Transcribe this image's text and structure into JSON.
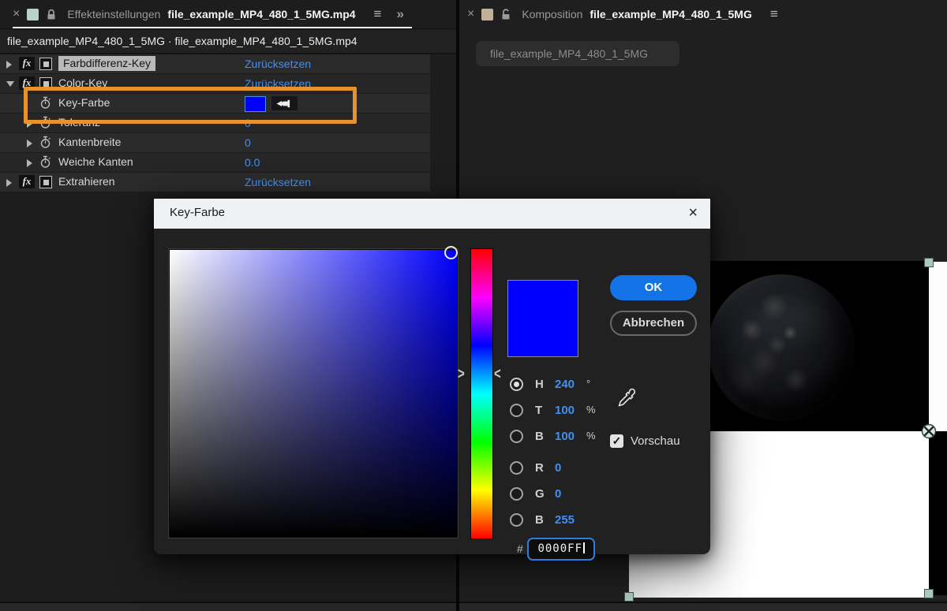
{
  "colors": {
    "key_color": "#0000ff",
    "accent_blue": "#4090f5",
    "annotation_orange": "#e6922f",
    "ok_blue": "#1473e6",
    "handle_teal": "#abc8bd"
  },
  "icons": {
    "close": "×",
    "menu": "≡",
    "overflow": "»",
    "fx": "fx",
    "check": "✓",
    "hue_arrow_left": ">",
    "hue_arrow_right": "<"
  },
  "left_panel": {
    "tab": {
      "panel_label": "Effekteinstellungen",
      "document": "file_example_MP4_480_1_5MG.mp4"
    },
    "subtitle": "file_example_MP4_480_1_5MG · file_example_MP4_480_1_5MG.mp4",
    "rows": [
      {
        "name": "Farbdifferenz-Key",
        "value": "Zurücksetzen"
      },
      {
        "name": "Color-Key",
        "value": "Zurücksetzen"
      },
      {
        "name": "Key-Farbe",
        "value": ""
      },
      {
        "name": "Toleranz",
        "value": "0"
      },
      {
        "name": "Kantenbreite",
        "value": "0"
      },
      {
        "name": "Weiche Kanten",
        "value": "0.0"
      },
      {
        "name": "Extrahieren",
        "value": "Zurücksetzen"
      }
    ]
  },
  "right_panel": {
    "tab": {
      "panel_label": "Komposition",
      "document": "file_example_MP4_480_1_5MG"
    },
    "chip": "file_example_MP4_480_1_5MG"
  },
  "dialog": {
    "title": "Key-Farbe",
    "ok": "OK",
    "cancel": "Abbrechen",
    "preview": "Vorschau",
    "hex_prefix": "#",
    "hex_value": "0000FF",
    "fields": [
      {
        "label": "H",
        "value": "240",
        "unit": "°"
      },
      {
        "label": "T",
        "value": "100",
        "unit": "%"
      },
      {
        "label": "B",
        "value": "100",
        "unit": "%"
      },
      {
        "label": "R",
        "value": "0",
        "unit": ""
      },
      {
        "label": "G",
        "value": "0",
        "unit": ""
      },
      {
        "label": "B",
        "value": "255",
        "unit": ""
      }
    ],
    "hue_degrees": 240
  }
}
